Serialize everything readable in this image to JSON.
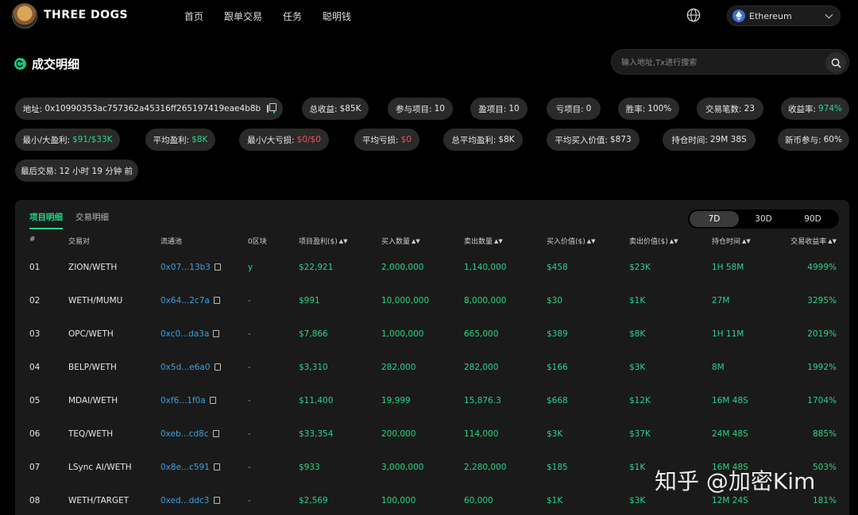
{
  "header": {
    "brand": "THREE DOGS",
    "nav": [
      "首页",
      "跟单交易",
      "任务",
      "聪明钱"
    ],
    "chain": "Ethereum"
  },
  "page": {
    "title": "成交明细",
    "search_placeholder": "输入地址,Tx进行搜索"
  },
  "stats": {
    "address_label": "地址:",
    "address_value": "0x10990353ac757362a45316ff265197419eae4b8b",
    "total_profit_label": "总收益:",
    "total_profit_value": "$85K",
    "projects_label": "参与项目:",
    "projects_value": "10",
    "win_projects_label": "盈项目:",
    "win_projects_value": "10",
    "loss_projects_label": "亏项目:",
    "loss_projects_value": "0",
    "winrate_label": "胜率:",
    "winrate_value": "100%",
    "trades_label": "交易笔数:",
    "trades_value": "23",
    "roi_label": "收益率:",
    "roi_value": "974%",
    "minmax_profit_label": "最小/大盈利:",
    "minmax_profit_value": "$91/$33K",
    "avg_profit_label": "平均盈利:",
    "avg_profit_value": "$8K",
    "minmax_loss_label": "最小/大亏损:",
    "minmax_loss_value": "$0/$0",
    "avg_loss_label": "平均亏损:",
    "avg_loss_value": "$0",
    "total_avg_label": "总平均盈利:",
    "total_avg_value": "$8K",
    "avg_buy_label": "平均买入价值:",
    "avg_buy_value": "$873",
    "hold_time_label": "持仓时间:",
    "hold_time_value": "29M 38S",
    "new_coin_label": "新币参与:",
    "new_coin_value": "60%",
    "last_trade_label": "最后交易:",
    "last_trade_value": "12 小时 19 分钟 前"
  },
  "table": {
    "tabs": [
      "项目明细",
      "交易明细"
    ],
    "ranges": [
      "7D",
      "30D",
      "90D"
    ],
    "columns": [
      "#",
      "交易对",
      "流通池",
      "0区块",
      "项目盈利($)",
      "买入数量",
      "卖出数量",
      "买入价值($)",
      "卖出价值($)",
      "持仓时间",
      "交易收益率"
    ],
    "rows": [
      {
        "idx": "01",
        "pair": "ZION/WETH",
        "pool": "0x07...13b3",
        "block0": "y",
        "profit": "$22,921",
        "buy_qty": "2,000,000",
        "sell_qty": "1,140,000",
        "buy_val": "$458",
        "sell_val": "$23K",
        "hold": "1H 58M",
        "roi": "4999%"
      },
      {
        "idx": "02",
        "pair": "WETH/MUMU",
        "pool": "0x64...2c7a",
        "block0": "-",
        "profit": "$991",
        "buy_qty": "10,000,000",
        "sell_qty": "8,000,000",
        "buy_val": "$30",
        "sell_val": "$1K",
        "hold": "27M",
        "roi": "3295%"
      },
      {
        "idx": "03",
        "pair": "OPC/WETH",
        "pool": "0xc0...da3a",
        "block0": "-",
        "profit": "$7,866",
        "buy_qty": "1,000,000",
        "sell_qty": "665,000",
        "buy_val": "$389",
        "sell_val": "$8K",
        "hold": "1H 11M",
        "roi": "2019%"
      },
      {
        "idx": "04",
        "pair": "BELP/WETH",
        "pool": "0x5d...e6a0",
        "block0": "-",
        "profit": "$3,310",
        "buy_qty": "282,000",
        "sell_qty": "282,000",
        "buy_val": "$166",
        "sell_val": "$3K",
        "hold": "8M",
        "roi": "1992%"
      },
      {
        "idx": "05",
        "pair": "MDAI/WETH",
        "pool": "0xf6...1f0a",
        "block0": "-",
        "profit": "$11,400",
        "buy_qty": "19,999",
        "sell_qty": "15,876.3",
        "buy_val": "$668",
        "sell_val": "$12K",
        "hold": "16M 48S",
        "roi": "1704%"
      },
      {
        "idx": "06",
        "pair": "TEQ/WETH",
        "pool": "0xeb...cd8c",
        "block0": "-",
        "profit": "$33,354",
        "buy_qty": "200,000",
        "sell_qty": "114,000",
        "buy_val": "$3K",
        "sell_val": "$37K",
        "hold": "24M 48S",
        "roi": "885%"
      },
      {
        "idx": "07",
        "pair": "LSync AI/WETH",
        "pool": "0x8e...c591",
        "block0": "-",
        "profit": "$933",
        "buy_qty": "3,000,000",
        "sell_qty": "2,280,000",
        "buy_val": "$185",
        "sell_val": "$1K",
        "hold": "16M 48S",
        "roi": "503%"
      },
      {
        "idx": "08",
        "pair": "WETH/TARGET",
        "pool": "0xed...ddc3",
        "block0": "-",
        "profit": "$2,569",
        "buy_qty": "100,000",
        "sell_qty": "60,000",
        "buy_val": "$1K",
        "sell_val": "$3K",
        "hold": "12M 24S",
        "roi": "181%"
      }
    ]
  },
  "watermark": "知乎 @加密Kim",
  "colors": {
    "accent": "#25d68a",
    "loss": "#f0505a",
    "link": "#3aa0e0"
  }
}
